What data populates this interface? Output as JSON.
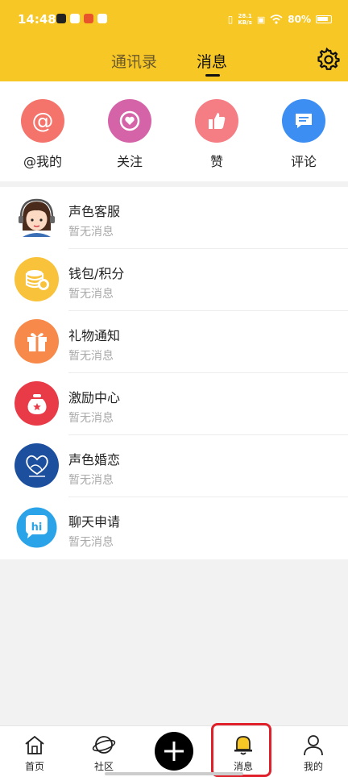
{
  "status_bar": {
    "time": "14:48",
    "net_speed_value": "28.1",
    "net_speed_unit": "KB/s",
    "battery": "80%"
  },
  "header": {
    "tabs": [
      {
        "label": "通讯录",
        "active": false
      },
      {
        "label": "消息",
        "active": true
      }
    ],
    "settings_icon": "gear-icon",
    "background_color": "#f7c726"
  },
  "quick_actions": [
    {
      "label": "@我的",
      "icon": "at-icon",
      "color": "#f4736b"
    },
    {
      "label": "关注",
      "icon": "heart-icon",
      "color": "#d563a8"
    },
    {
      "label": "赞",
      "icon": "thumbs-up-icon",
      "color": "#f57d84"
    },
    {
      "label": "评论",
      "icon": "comment-icon",
      "color": "#3d8ef2"
    }
  ],
  "messages": [
    {
      "title": "声色客服",
      "subtitle": "暂无消息",
      "icon": "support-agent-avatar"
    },
    {
      "title": "钱包/积分",
      "subtitle": "暂无消息",
      "icon": "coins-icon",
      "color": "#f8c23a"
    },
    {
      "title": "礼物通知",
      "subtitle": "暂无消息",
      "icon": "gift-icon",
      "color": "#f7894a"
    },
    {
      "title": "激励中心",
      "subtitle": "暂无消息",
      "icon": "reward-bag-icon",
      "color": "#e93a47"
    },
    {
      "title": "声色婚恋",
      "subtitle": "暂无消息",
      "icon": "heart-logo-icon",
      "color": "#1c4f9e"
    },
    {
      "title": "聊天申请",
      "subtitle": "暂无消息",
      "icon": "hi-chat-icon",
      "color": "#2aa3e8"
    }
  ],
  "bottom_nav": [
    {
      "label": "首页",
      "icon": "home-icon"
    },
    {
      "label": "社区",
      "icon": "planet-icon"
    },
    {
      "label": "",
      "icon": "plus-icon"
    },
    {
      "label": "消息",
      "icon": "bell-icon",
      "active": true
    },
    {
      "label": "我的",
      "icon": "person-icon"
    }
  ]
}
